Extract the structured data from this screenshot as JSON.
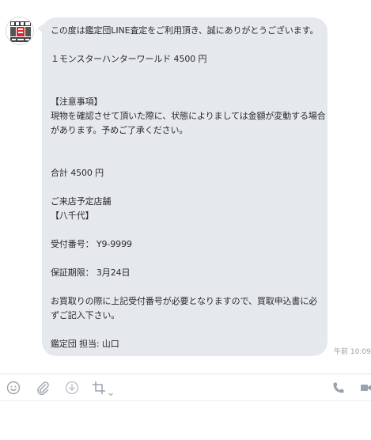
{
  "message": {
    "lines": [
      "この度は鑑定団LINE査定をご利用頂き、誠にありがとうございます。",
      "",
      "１モンスターハンターワールド 4500 円",
      "",
      "",
      "【注意事項】",
      "現物を確認させて頂いた際に、状態によりましては金額が変動する場合",
      "があります。予めご了承ください。",
      "",
      "",
      "合計 4500 円",
      "",
      "ご来店予定店舗",
      "【八千代】",
      "",
      "受付番号： Y9-9999",
      "",
      "保証期限： 3月24日",
      "",
      "お買取りの際に上記受付番号が必要となりますので、買取申込書に必",
      "ずご記入下さい。",
      "",
      "鑑定団 担当: 山口"
    ],
    "timestamp": "午前 10:09"
  },
  "toolbar": {
    "items": [
      "emoji-icon",
      "attach-icon",
      "download-icon",
      "crop-icon",
      "phone-icon",
      "video-icon"
    ]
  },
  "colors": {
    "bubble": "#e5e8ec",
    "icon": "#9aa3ad",
    "text": "#2a2a2a",
    "logo_red": "#d9262c"
  }
}
